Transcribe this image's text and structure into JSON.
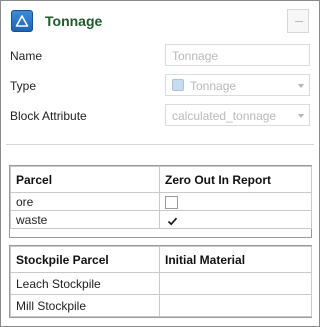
{
  "header": {
    "title": "Tonnage",
    "icon": "triangle-up-icon",
    "collapse_icon": "minus-icon"
  },
  "fields": {
    "name": {
      "label": "Name",
      "value": "Tonnage"
    },
    "type": {
      "label": "Type",
      "value": "Tonnage",
      "icon": "type-icon"
    },
    "block_attribute": {
      "label": "Block Attribute",
      "value": "calculated_tonnage"
    }
  },
  "parcel_table": {
    "headers": [
      "Parcel",
      "Zero Out In Report"
    ],
    "rows": [
      {
        "parcel": "ore",
        "zero_out": false
      },
      {
        "parcel": "waste",
        "zero_out": true
      }
    ]
  },
  "stockpile_table": {
    "headers": [
      "Stockpile Parcel",
      "Initial Material"
    ],
    "rows": [
      {
        "parcel": "Leach Stockpile",
        "initial": ""
      },
      {
        "parcel": "Mill Stockpile",
        "initial": ""
      }
    ]
  },
  "colors": {
    "title": "#1e5a2a",
    "icon_blue": "#1f64b4",
    "disabled_text": "#b9b9b9"
  }
}
